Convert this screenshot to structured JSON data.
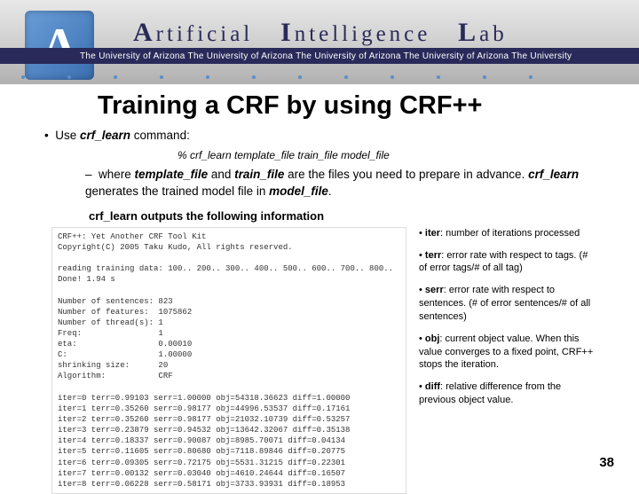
{
  "banner": {
    "word1": "rtificial",
    "word2": "ntelligence",
    "word3": "ab",
    "bar_text": "The University of Arizona   The University of Arizona   The University of Arizona   The University of Arizona   The University"
  },
  "title": "Training a CRF by using CRF++",
  "bullet1_pre": "Use ",
  "bullet1_cmd": "crf_learn",
  "bullet1_post": " command:",
  "command": "% crf_learn template_file train_file model_file",
  "bullet2": {
    "t1": "where ",
    "tf": "template_file",
    "t2": " and ",
    "trf": "train_file",
    "t3": " are the files you need to prepare in advance. ",
    "cl": "crf_learn",
    "t4": " generates the trained model file in ",
    "mf": "model_file",
    "t5": "."
  },
  "outputs_label": "crf_learn outputs the following information",
  "console": "CRF++: Yet Another CRF Tool Kit\nCopyright(C) 2005 Taku Kudo, All rights reserved.\n\nreading training data: 100.. 200.. 300.. 400.. 500.. 600.. 700.. 800.. \nDone! 1.94 s\n\nNumber of sentences: 823\nNumber of features:  1075862\nNumber of thread(s): 1\nFreq:                1\neta:                 0.00010\nC:                   1.00000\nshrinking size:      20\nAlgorithm:           CRF\n\niter=0 terr=0.99103 serr=1.00000 obj=54318.36623 diff=1.00000\niter=1 terr=0.35260 serr=0.98177 obj=44996.53537 diff=0.17161\niter=2 terr=0.35260 serr=0.98177 obj=21032.10739 diff=0.53257\niter=3 terr=0.23879 serr=0.94532 obj=13642.32067 diff=0.35138\niter=4 terr=0.18337 serr=0.90087 obj=8985.70071 diff=0.04134\niter=5 terr=0.11605 serr=0.80680 obj=7118.89846 diff=0.20775\niter=6 terr=0.09305 serr=0.72175 obj=5531.31215 diff=0.22301\niter=7 terr=0.00132 serr=0.03040 obj=4610.24644 diff=0.16507\niter=8 terr=0.06228 serr=0.58171 obj=3733.93931 diff=0.18953",
  "defs": {
    "iter_k": "iter",
    "iter_v": ": number of iterations processed",
    "terr_k": "terr",
    "terr_v": ": error rate with respect to tags. (# of error tags/# of all tag)",
    "serr_k": "serr",
    "serr_v": ": error rate with respect to sentences. (# of error sentences/# of all sentences)",
    "obj_k": "obj",
    "obj_v": ": current object value. When this value converges to a fixed point, CRF++ stops the iteration.",
    "diff_k": "diff",
    "diff_v": ": relative difference from the previous object value."
  },
  "page_num": "38"
}
